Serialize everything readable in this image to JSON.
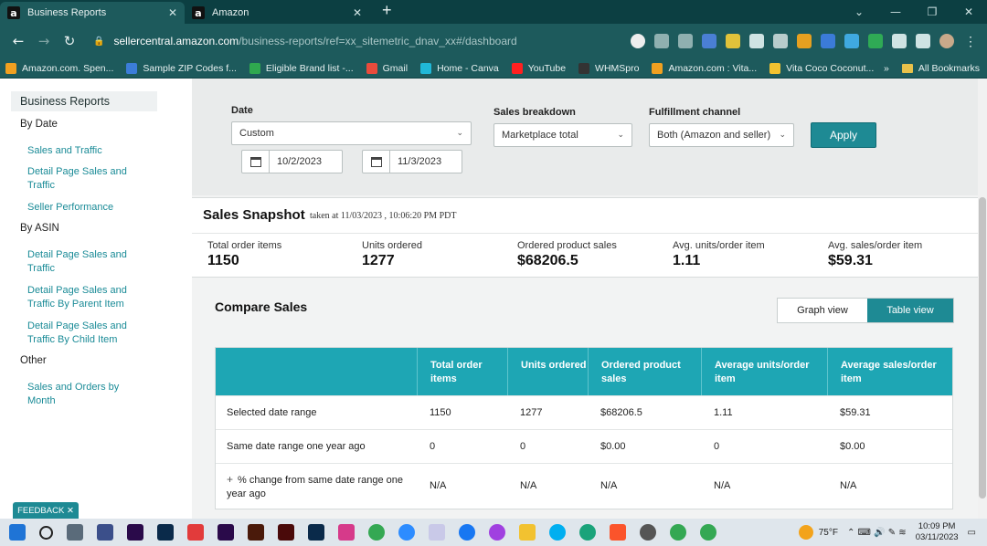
{
  "browser": {
    "tabs": [
      {
        "title": "Business Reports",
        "active": true
      },
      {
        "title": "Amazon",
        "active": false
      }
    ],
    "url_host": "sellercentral.amazon.com",
    "url_path": "/business-reports/ref=xx_sitemetric_dnav_xx#/dashboard",
    "bookmarks": [
      {
        "label": "Amazon.com. Spen...",
        "color": "#f0a020"
      },
      {
        "label": "Sample ZIP Codes f...",
        "color": "#3c7dd9"
      },
      {
        "label": "Eligible Brand list -...",
        "color": "#2fa84f"
      },
      {
        "label": "Gmail",
        "color": "#e94b3c"
      },
      {
        "label": "Home - Canva",
        "color": "#20b8d8"
      },
      {
        "label": "YouTube",
        "color": "#ff2020"
      },
      {
        "label": "WHMSpro",
        "color": "#333333"
      },
      {
        "label": "Amazon.com : Vita...",
        "color": "#f0a020"
      },
      {
        "label": "Vita Coco Coconut...",
        "color": "#f2c230"
      }
    ],
    "more_bookmarks": "»",
    "all_bookmarks": "All Bookmarks"
  },
  "sidebar": {
    "header": "Business Reports",
    "by_date": "By Date",
    "by_date_links": [
      "Sales and Traffic",
      "Detail Page Sales and Traffic",
      "Seller Performance"
    ],
    "by_asin": "By ASIN",
    "by_asin_links": [
      "Detail Page Sales and Traffic",
      "Detail Page Sales and Traffic By Parent Item",
      "Detail Page Sales and Traffic By Child Item"
    ],
    "other": "Other",
    "other_links": [
      "Sales and Orders by Month"
    ]
  },
  "filters": {
    "date_label": "Date",
    "date_select": "Custom",
    "start_date": "10/2/2023",
    "end_date": "11/3/2023",
    "breakdown_label": "Sales breakdown",
    "breakdown_value": "Marketplace total",
    "channel_label": "Fulfillment channel",
    "channel_value": "Both (Amazon and seller)",
    "apply": "Apply"
  },
  "snapshot": {
    "title": "Sales Snapshot",
    "taken": "taken at 11/03/2023 , 10:06:20 PM PDT",
    "metrics": [
      {
        "label": "Total order items",
        "value": "1150"
      },
      {
        "label": "Units ordered",
        "value": "1277"
      },
      {
        "label": "Ordered product sales",
        "value": "$68206.5"
      },
      {
        "label": "Avg. units/order item",
        "value": "1.11"
      },
      {
        "label": "Avg. sales/order item",
        "value": "$59.31"
      }
    ]
  },
  "compare": {
    "title": "Compare Sales",
    "graph_view": "Graph view",
    "table_view": "Table view",
    "headers": [
      "",
      "Total order items",
      "Units ordered",
      "Ordered product sales",
      "Average units/order item",
      "Average sales/order item"
    ],
    "rows": [
      [
        "Selected date range",
        "1150",
        "1277",
        "$68206.5",
        "1.11",
        "$59.31"
      ],
      [
        "Same date range one year ago",
        "0",
        "0",
        "$0.00",
        "0",
        "$0.00"
      ],
      [
        "% change from same date range one year ago",
        "N/A",
        "N/A",
        "N/A",
        "N/A",
        "N/A"
      ]
    ]
  },
  "feedback": "FEEDBACK",
  "taskbar": {
    "temperature": "75°F",
    "time": "10:09 PM",
    "date": "03/11/2023"
  }
}
